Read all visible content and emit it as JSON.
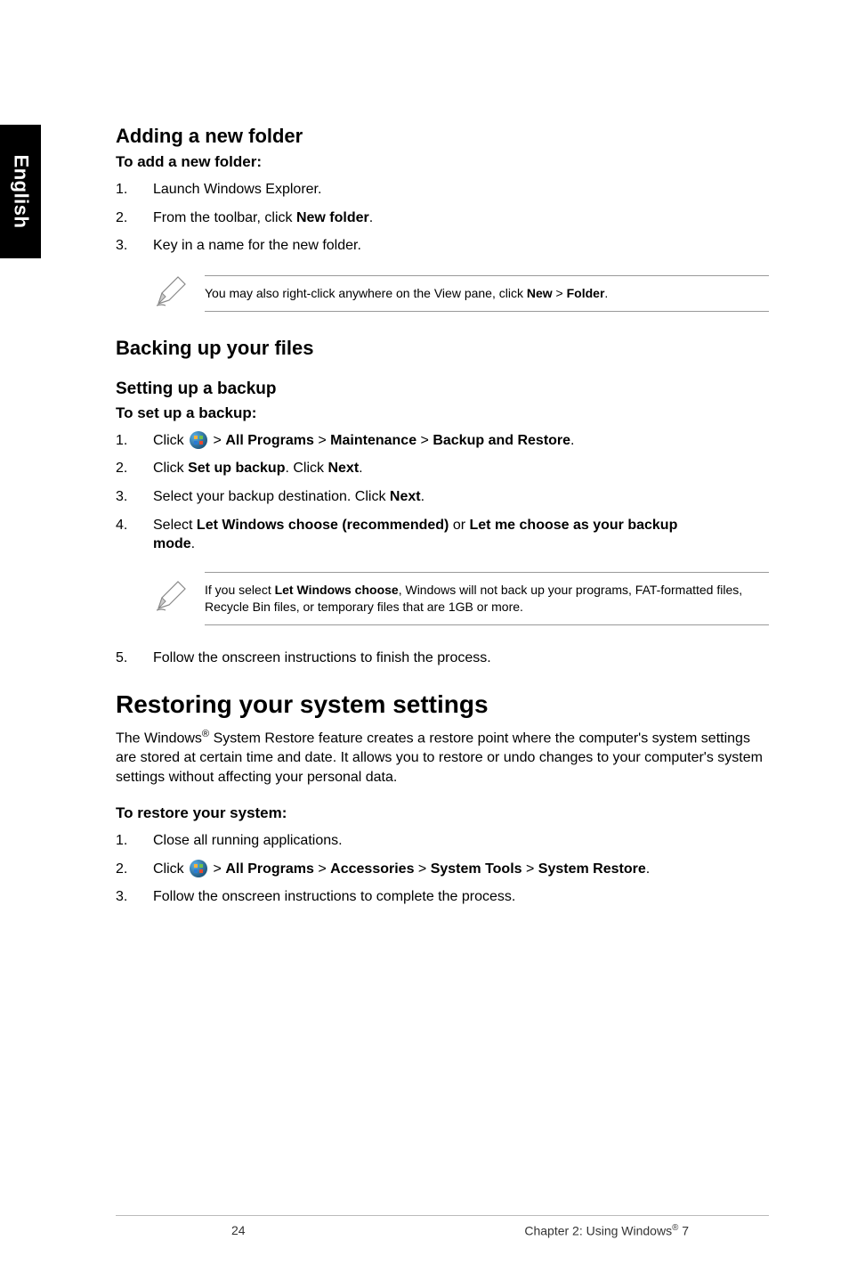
{
  "sideTab": "English",
  "addFolder": {
    "heading": "Adding a new folder",
    "sub": "To add a new folder:",
    "steps": [
      {
        "n": "1.",
        "t": "Launch Windows Explorer."
      },
      {
        "n": "2.",
        "pre": "From the toolbar, click ",
        "b1": "New folder",
        "post": "."
      },
      {
        "n": "3.",
        "t": "Key in a name for the new folder."
      }
    ],
    "note": {
      "pre": "You may also right-click anywhere on the View pane, click ",
      "b1": "New",
      "mid": " > ",
      "b2": "Folder",
      "post": "."
    }
  },
  "backup": {
    "heading": "Backing up your files",
    "sub1": "Setting up a backup",
    "sub2": "To set up a backup:",
    "steps": [
      {
        "n": "1.",
        "pre": "Click ",
        "mid": " > ",
        "b1": "All Programs",
        "b2": "Maintenance",
        "b3": "Backup and Restore",
        "post": "."
      },
      {
        "n": "2.",
        "pre": "Click ",
        "b1": "Set up backup",
        "mid": ". Click ",
        "b2": "Next",
        "post": "."
      },
      {
        "n": "3.",
        "pre": "Select your backup destination. Click ",
        "b1": "Next",
        "post": "."
      },
      {
        "n": "4.",
        "pre": "Select ",
        "b1": "Let Windows choose (recommended)",
        "mid": " or ",
        "b2": "Let me choose as your backup",
        "line2b": "mode",
        "line2post": "."
      }
    ],
    "note": {
      "pre": "If you select ",
      "b1": "Let Windows choose",
      "post": ", Windows will not back up your programs, FAT-formatted files, Recycle Bin files, or temporary files that are 1GB or more."
    },
    "final": {
      "n": "5.",
      "t": "Follow the onscreen instructions to finish the process."
    }
  },
  "restore": {
    "heading": "Restoring your system settings",
    "para": {
      "pre": "The Windows",
      "sup": "®",
      "post": " System Restore feature creates a restore point where the computer's system settings are stored at certain time and date. It allows you to restore or undo changes to your computer's system settings without affecting your personal data."
    },
    "sub": "To restore your system:",
    "steps": [
      {
        "n": "1.",
        "t": "Close all running applications."
      },
      {
        "n": "2.",
        "pre": "Click ",
        "mid": " > ",
        "b1": "All Programs",
        "b2": "Accessories",
        "b3": "System Tools",
        "b4": "System Restore",
        "post": "."
      },
      {
        "n": "3.",
        "t": "Follow the onscreen instructions to complete the process."
      }
    ]
  },
  "footer": {
    "page": "24",
    "chapterPre": "Chapter 2: Using Windows",
    "sup": "®",
    "chapterPost": " 7"
  }
}
